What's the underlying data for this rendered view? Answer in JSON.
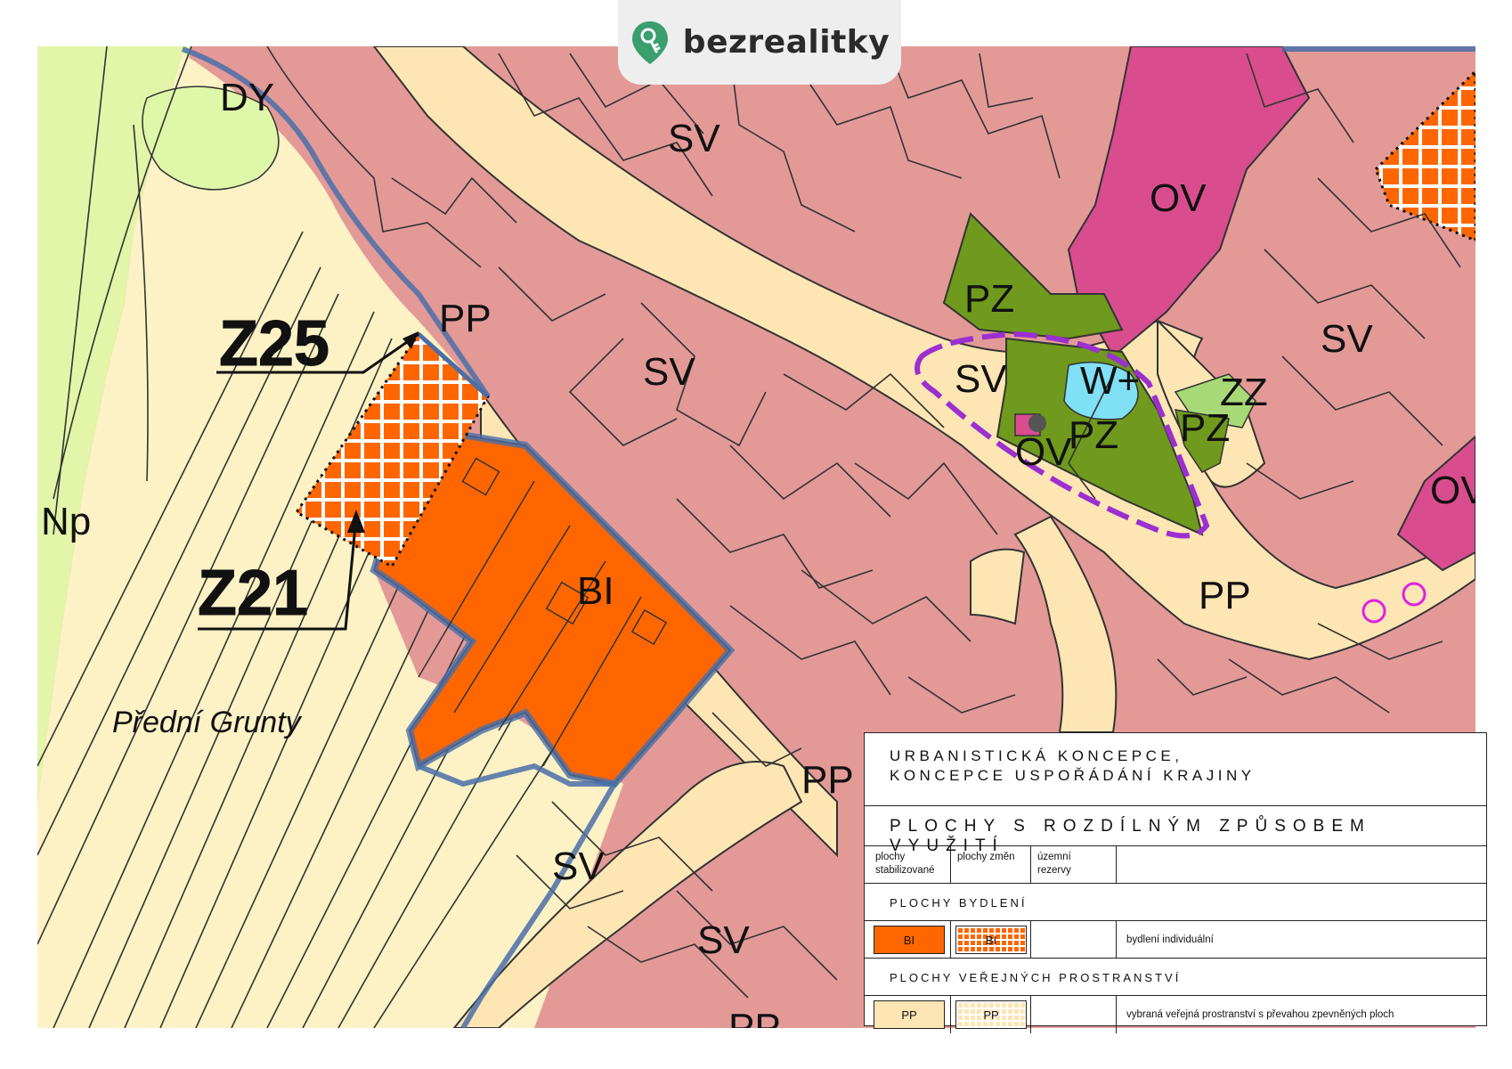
{
  "brand": {
    "name": "bezrealitky",
    "icon": "key-pin-icon",
    "color": "#3a9e6e"
  },
  "colors": {
    "sv": "#e39a97",
    "bi": "#ff6600",
    "ov": "#d94d8f",
    "pz": "#6f9a1d",
    "zz": "#a8d977",
    "pp": "#fde6b4",
    "np": "#e3f5a8",
    "water": "#80e0f5",
    "boundary": "#4a6ea8",
    "purple_dash": "#9b2fd0"
  },
  "map_labels": {
    "sv_1": "SV",
    "sv_2": "SV",
    "sv_3": "SV",
    "sv_4": "SV",
    "sv_5": "SV",
    "sv_6": "SV",
    "ov_1": "OV",
    "ov_2": "OV",
    "ov_3": "OV",
    "pz_1": "PZ",
    "pz_2": "PZ",
    "pz_3": "PZ",
    "zz": "ZZ",
    "w_plus": "W+",
    "pp_1": "PP",
    "pp_2": "PP",
    "pp_3": "PP",
    "pp_4": "PP",
    "bi": "BI",
    "np": "Np",
    "dy": "DY",
    "place_name": "Přední Grunty",
    "zone_z25": "Z25",
    "zone_z21": "Z21"
  },
  "legend": {
    "title_line1": "URBANISTICKÁ KONCEPCE,",
    "title_line2": "KONCEPCE USPOŘÁDÁNÍ KRAJINY",
    "heading": "PLOCHY S ROZDÍLNÝM ZPŮSOBEM VYUŽITÍ",
    "col1": "plochy stabilizované",
    "col2": "plochy změn",
    "col3": "územní rezervy",
    "section1": "PLOCHY BYDLENÍ",
    "bi_label": "BI",
    "bi_desc": "bydlení individuální",
    "section2": "PLOCHY VEŘEJNÝCH PROSTRANSTVÍ",
    "pp_label": "PP",
    "pp_desc": "vybraná veřejná prostranství s převahou zpevněných ploch"
  }
}
